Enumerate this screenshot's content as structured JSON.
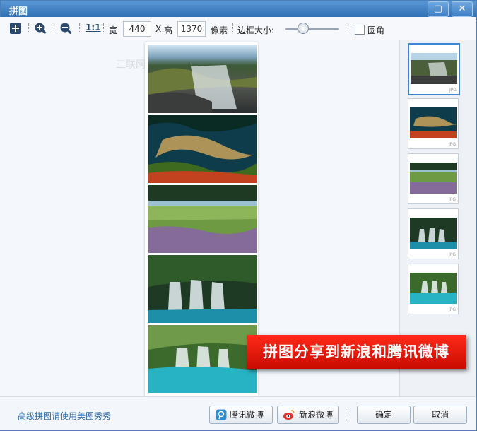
{
  "window": {
    "title": "拼图"
  },
  "titlebar": {
    "maximize_glyph": "▢",
    "close_glyph": "✕"
  },
  "toolbar": {
    "width_label": "宽",
    "width_value": "440",
    "x_label": "X",
    "height_label": "高",
    "height_value": "1370",
    "unit_label": "像素",
    "border_label": "边框大小:",
    "rounded_label": "圆角",
    "one_to_one": "1:1",
    "border_level_fraction": 0.32
  },
  "watermark": "三联网 3LIAN.COM",
  "thumbnails": [
    {
      "tag": "JPG"
    },
    {
      "tag": "JPG"
    },
    {
      "tag": "JPG"
    },
    {
      "tag": "JPG"
    },
    {
      "tag": "JPG"
    }
  ],
  "banner": "拼图分享到新浪和腾讯微博",
  "footer": {
    "advanced_link": "高级拼图请使用美图秀秀",
    "tencent_button": "腾讯微博",
    "sina_button": "新浪微博",
    "ok_button": "确定",
    "cancel_button": "取消"
  },
  "colors": {
    "titlebar": "#2f6fb3",
    "banner": "#e01a0c",
    "selected": "#3b86d6"
  }
}
